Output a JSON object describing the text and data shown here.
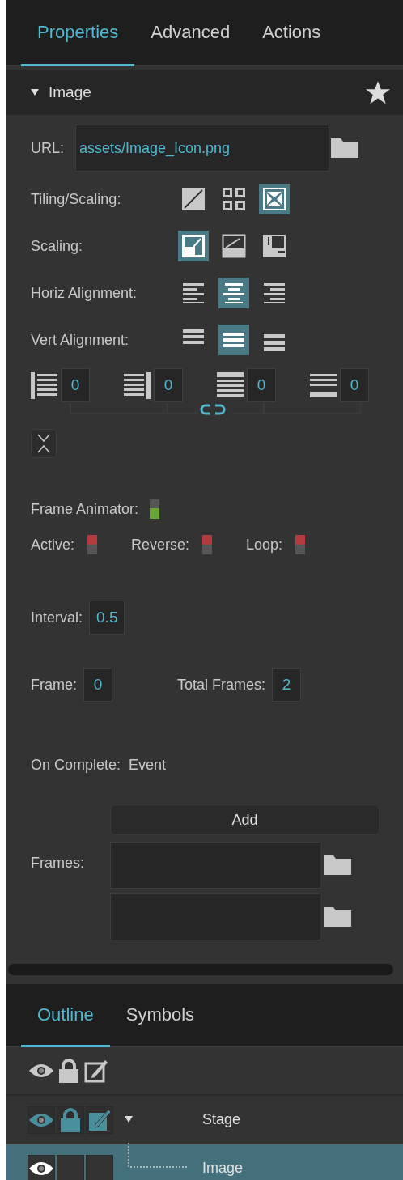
{
  "tabs": [
    {
      "label": "Properties",
      "selected": true
    },
    {
      "label": "Advanced",
      "selected": false
    },
    {
      "label": "Actions",
      "selected": false
    }
  ],
  "section": {
    "title": "Image",
    "expanded": true
  },
  "url": {
    "label": "URL:",
    "value": "assets/Image_Icon.png"
  },
  "option_rows": [
    {
      "label": "Tiling/Scaling:",
      "options": [
        {
          "kind": "stretch",
          "selected": false
        },
        {
          "kind": "tile",
          "selected": false
        },
        {
          "kind": "fit",
          "selected": true
        }
      ]
    },
    {
      "label": "Scaling:",
      "options": [
        {
          "kind": "fill",
          "selected": true
        },
        {
          "kind": "scale",
          "selected": false
        },
        {
          "kind": "offset",
          "selected": false
        }
      ]
    },
    {
      "label": "Horiz Alignment:",
      "options": [
        {
          "kind": "left",
          "selected": false
        },
        {
          "kind": "center",
          "selected": true
        },
        {
          "kind": "right",
          "selected": false
        }
      ]
    },
    {
      "label": "Vert Alignment:",
      "options": [
        {
          "kind": "top",
          "selected": false
        },
        {
          "kind": "middle",
          "selected": true
        },
        {
          "kind": "bottom",
          "selected": false
        }
      ]
    }
  ],
  "padding": [
    {
      "kind": "left",
      "value": "0"
    },
    {
      "kind": "right",
      "value": "0"
    },
    {
      "kind": "top",
      "value": "0"
    },
    {
      "kind": "bottom",
      "value": "0"
    }
  ],
  "frame_animator": {
    "label": "Frame Animator:",
    "on": true
  },
  "toggles": [
    {
      "label": "Active:",
      "on": false
    },
    {
      "label": "Reverse:",
      "on": false
    },
    {
      "label": "Loop:",
      "on": false
    }
  ],
  "interval": {
    "label": "Interval:",
    "value": "0.5"
  },
  "frame": {
    "label": "Frame:",
    "value": "0"
  },
  "total_frames": {
    "label": "Total Frames:",
    "value": "2"
  },
  "on_complete": {
    "label": "On Complete:",
    "value": "Event"
  },
  "add_button": "Add",
  "frames": {
    "label": "Frames:",
    "fields": [
      {
        "kind": "file"
      },
      {
        "kind": "file"
      }
    ]
  },
  "bottom_tabs": [
    {
      "label": "Outline",
      "selected": true
    },
    {
      "label": "Symbols",
      "selected": false
    }
  ],
  "outline": [
    {
      "label": "Stage",
      "expanded": true,
      "selected": false,
      "visible": true,
      "locked": true,
      "editable": true,
      "children": [
        {
          "label": "Image",
          "selected": true,
          "visible": true,
          "locked": false,
          "editable": false
        }
      ]
    }
  ]
}
